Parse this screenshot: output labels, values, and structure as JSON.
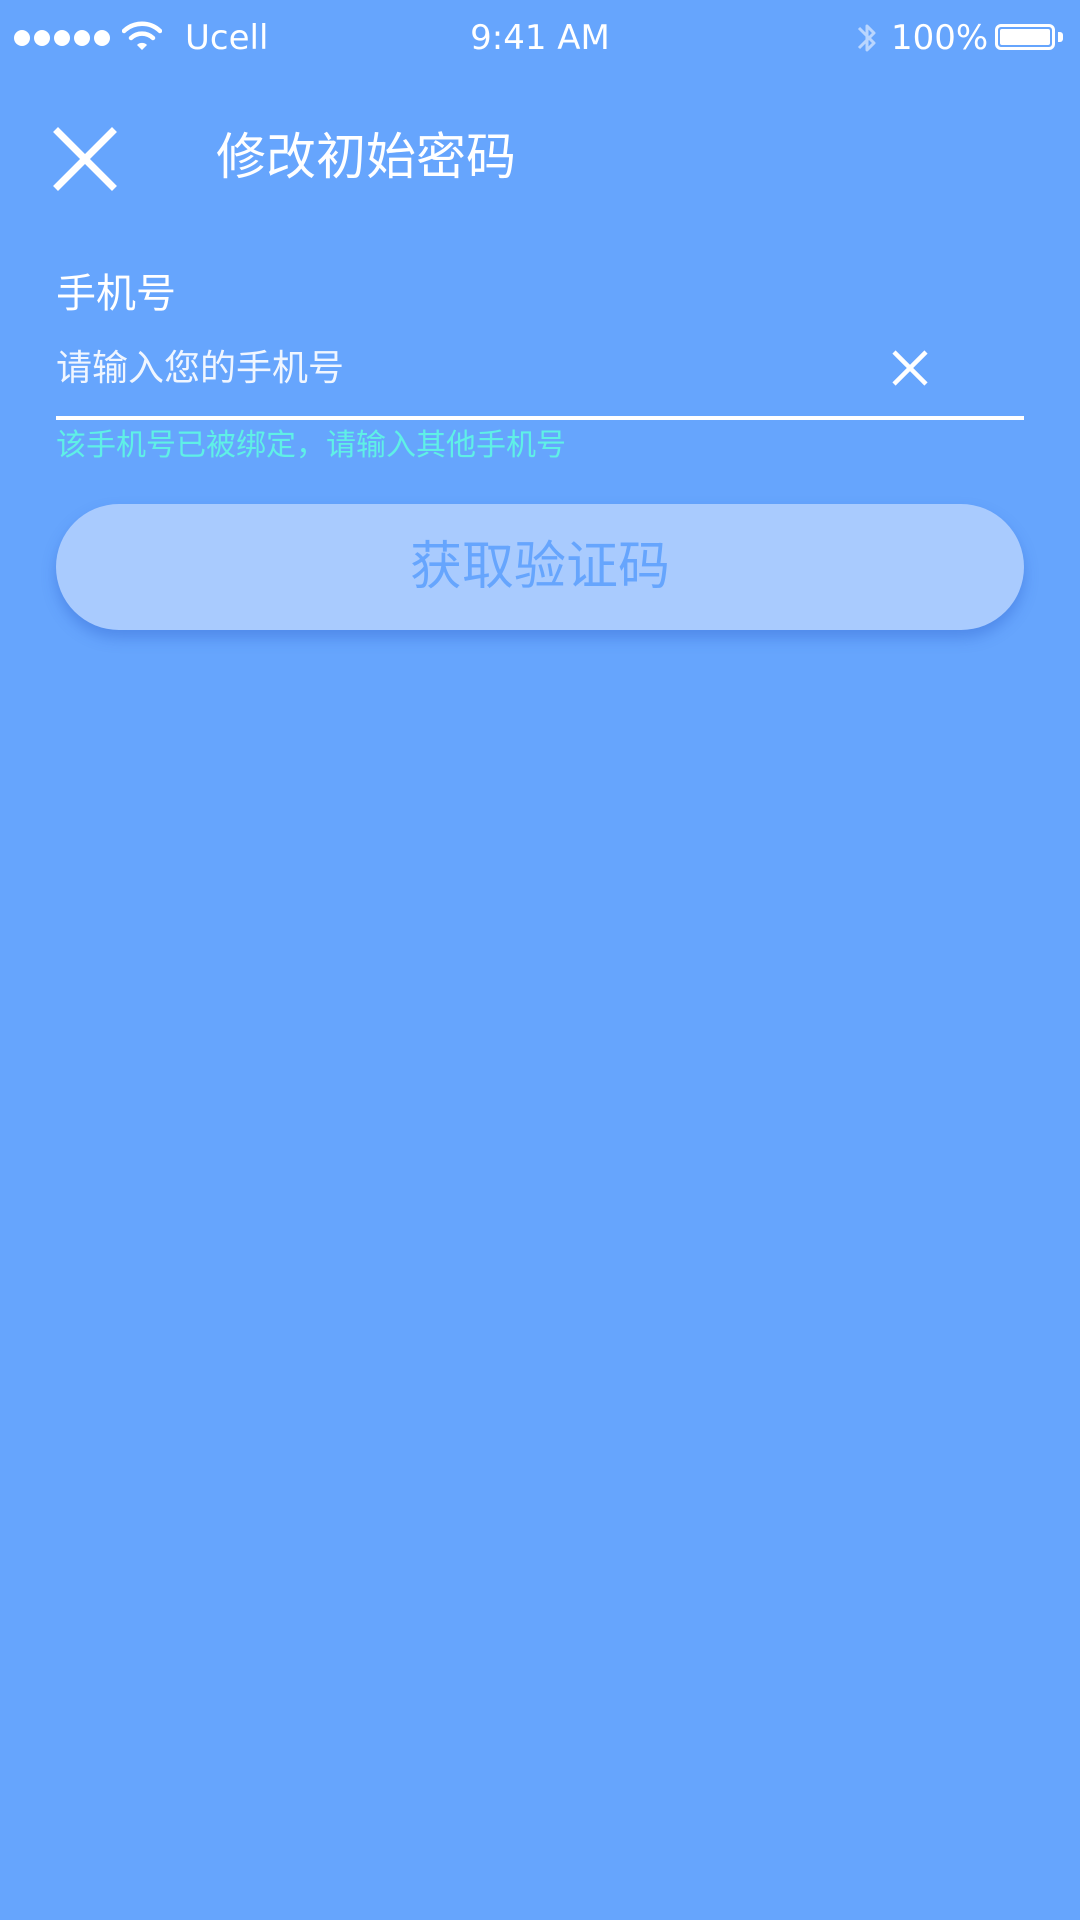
{
  "status_bar": {
    "carrier": "Ucell",
    "time": "9:41 AM",
    "battery_percent": "100%",
    "battery_level": 1.0,
    "signal_bars": 5,
    "icons": [
      "signal-dots-icon",
      "wifi-icon",
      "bluetooth-icon",
      "battery-icon"
    ]
  },
  "header": {
    "title": "修改初始密码",
    "close_icon": "close-icon"
  },
  "form": {
    "phone_label": "手机号",
    "phone_value": "",
    "phone_placeholder": "请输入您的手机号",
    "clear_icon": "clear-icon",
    "error_message": "该手机号已被绑定，请输入其他手机号",
    "submit_label": "获取验证码"
  },
  "colors": {
    "background": "#66a5fd",
    "error": "#5ff0e6",
    "button_bg": "#a9cbfe",
    "button_text": "#66a5fd"
  }
}
